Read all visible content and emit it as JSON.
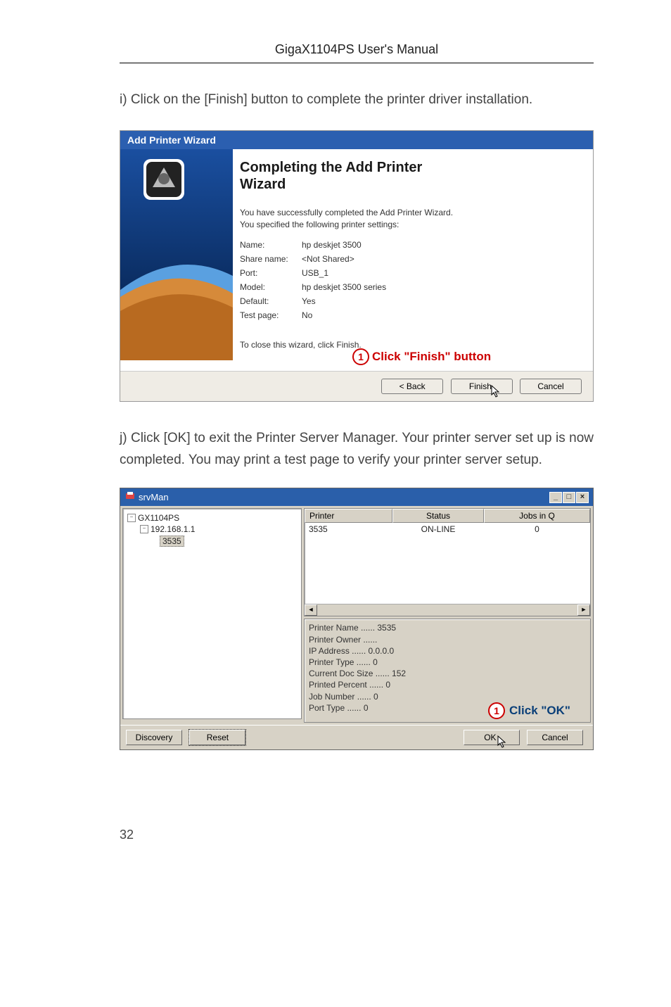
{
  "header": {
    "title": "GigaX1104PS User's Manual"
  },
  "para1": "i) Click on the [Finish] button to complete the printer driver installation.",
  "para2": "j) Click [OK] to exit the Printer Server Manager. Your printer server set up is now completed. You may print a test page to verify your printer server setup.",
  "pageNumber": "32",
  "apw": {
    "titlebar": "Add Printer Wizard",
    "heading_l1": "Completing the Add Printer",
    "heading_l2": "Wizard",
    "sub_l1": "You have successfully completed the Add Printer Wizard.",
    "sub_l2": "You specified the following printer settings:",
    "rows": [
      {
        "k": "Name:",
        "v": "hp deskjet 3500"
      },
      {
        "k": "Share name:",
        "v": "<Not Shared>"
      },
      {
        "k": "Port:",
        "v": "USB_1"
      },
      {
        "k": "Model:",
        "v": "hp deskjet 3500 series"
      },
      {
        "k": "Default:",
        "v": "Yes"
      },
      {
        "k": "Test page:",
        "v": "No"
      }
    ],
    "closeText": "To close this wizard, click Finish.",
    "annotation": {
      "num": "1",
      "text": "Click \"Finish\" button"
    },
    "buttons": {
      "back": "< Back",
      "finish": "Finish",
      "cancel": "Cancel"
    }
  },
  "srv": {
    "title": "srvMan",
    "tree": {
      "root": "GX1104PS",
      "ip": "192.168.1.1",
      "leaf": "3535"
    },
    "table": {
      "headers": {
        "c1": "Printer",
        "c2": "Status",
        "c3": "Jobs in Q"
      },
      "row": {
        "c1": "3535",
        "c2": "ON-LINE",
        "c3": "0"
      }
    },
    "info": [
      "Printer Name ...... 3535",
      "Printer Owner ......",
      "IP Address ...... 0.0.0.0",
      "Printer Type ...... 0",
      "Current Doc Size ...... 152",
      "Printed Percent ...... 0",
      "Job Number ...... 0",
      "Port Type ...... 0"
    ],
    "annotation": {
      "num": "1",
      "text": "Click \"OK\""
    },
    "buttons": {
      "discovery": "Discovery",
      "reset": "Reset",
      "ok": "OK",
      "cancel": "Cancel"
    }
  },
  "icons": {
    "min": "_",
    "max": "□",
    "close": "×",
    "left": "◄",
    "right": "►"
  }
}
